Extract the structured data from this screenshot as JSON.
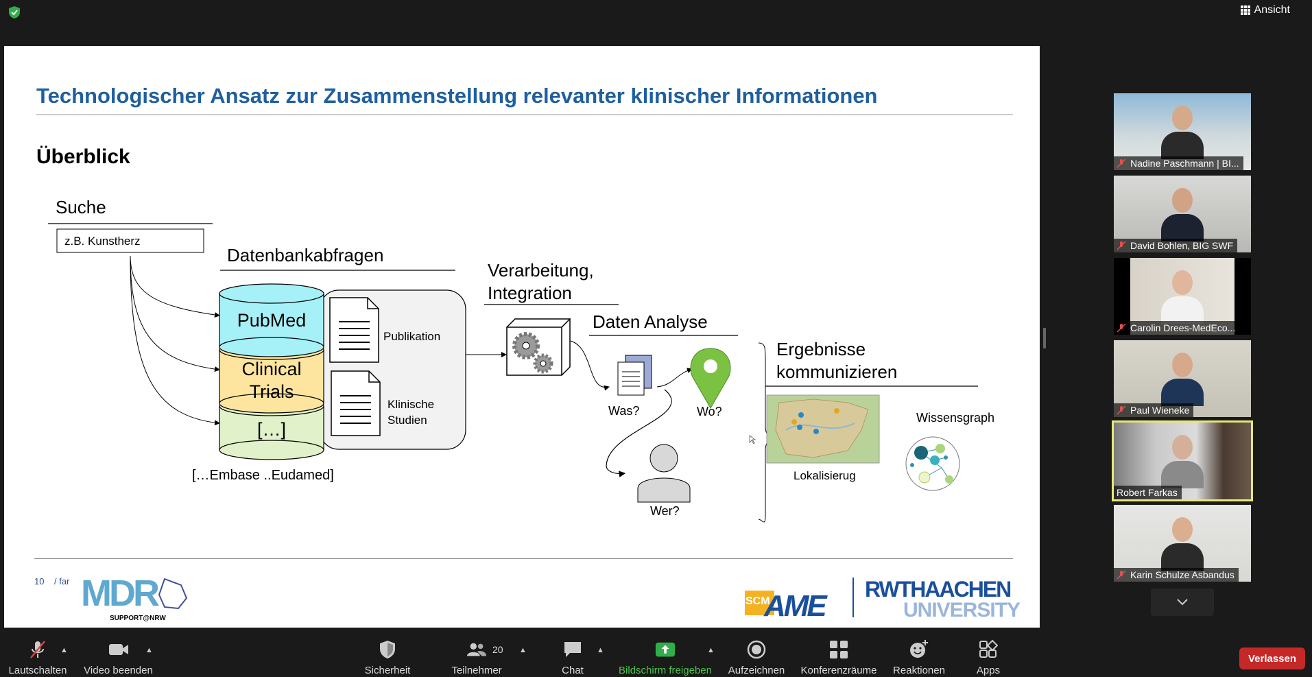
{
  "topbar": {
    "view_label": "Ansicht"
  },
  "slide": {
    "title": "Technologischer Ansatz zur Zusammenstellung relevanter klinischer Informationen",
    "section": "Überblick",
    "page_number": "10",
    "author": "/ far",
    "diagram": {
      "search_heading": "Suche",
      "search_example": "z.B.  Kunstherz",
      "db_heading": "Datenbankabfragen",
      "db_pubmed": "PubMed",
      "db_clinical_1": "Clinical",
      "db_clinical_2": "Trials",
      "db_more": "[…]",
      "db_note": "[…Embase ..Eudamed]",
      "doc_publication": "Publikation",
      "doc_trials_1": "Klinische",
      "doc_trials_2": "Studien",
      "processing_1": "Verarbeitung,",
      "processing_2": "Integration",
      "analysis_heading": "Daten Analyse",
      "what": "Was?",
      "where": "Wo?",
      "who": "Wer?",
      "results_1": "Ergebnisse",
      "results_2": "kommunizieren",
      "map_label": "Lokalisierug",
      "graph_label": "Wissensgraph"
    },
    "logos": {
      "mdr_main": "MDR",
      "mdr_sub": "SUPPORT@NRW",
      "scm": "SCM",
      "ame": "AME",
      "rwth_1": "RWTHAACHEN",
      "rwth_2": "UNIVERSITY"
    }
  },
  "participants": [
    {
      "name": "Nadine Paschmann | BI...",
      "muted": true,
      "active": false
    },
    {
      "name": "David Bohlen, BIG SWF",
      "muted": true,
      "active": false
    },
    {
      "name": "Carolin Drees-MedEco...",
      "muted": true,
      "active": false
    },
    {
      "name": "Paul Wieneke",
      "muted": true,
      "active": false
    },
    {
      "name": "Robert Farkas",
      "muted": false,
      "active": true
    },
    {
      "name": "Karin Schulze Asbandus",
      "muted": true,
      "active": false
    }
  ],
  "toolbar": {
    "mute": "Lautschalten",
    "video": "Video beenden",
    "security": "Sicherheit",
    "participants": "Teilnehmer",
    "participants_count": "20",
    "chat": "Chat",
    "share": "Bildschirm freigeben",
    "record": "Aufzeichnen",
    "breakout": "Konferenzräume",
    "reactions": "Reaktionen",
    "apps": "Apps",
    "leave": "Verlassen"
  },
  "colors": {
    "title_blue": "#1f5fa0",
    "pubmed_fill": "#a6f0f8",
    "clinical_fill": "#fde5a0",
    "more_fill": "#e1f1c9",
    "pin_green": "#7cc242",
    "share_green": "#4ec24e",
    "leave_red": "#c62828",
    "active_speaker": "#e7e87a"
  }
}
